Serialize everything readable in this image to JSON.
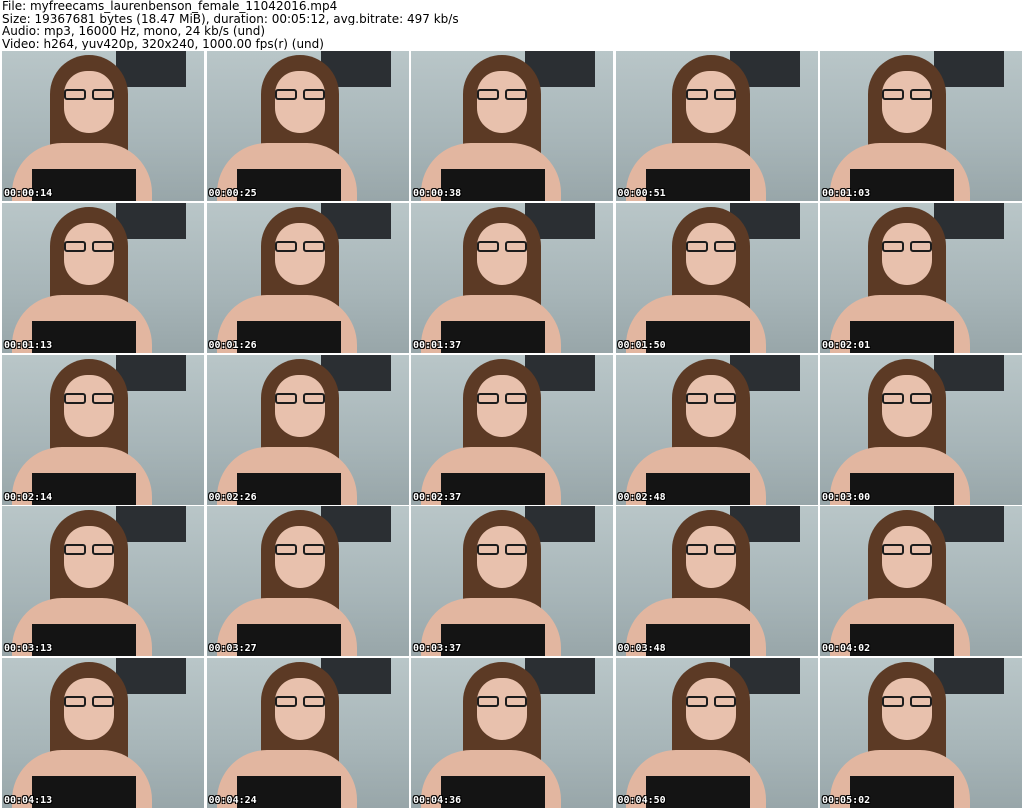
{
  "header": {
    "file_line": "File: myfreecams_laurenbenson_female_11042016.mp4",
    "size_line": "Size: 19367681 bytes (18.47 MiB), duration: 00:05:12, avg.bitrate: 497 kb/s",
    "audio_line": "Audio: mp3, 16000 Hz, mono, 24 kb/s (und)",
    "video_line": "Video: h264, yuv420p, 320x240, 1000.00 fps(r) (und)"
  },
  "thumbnails": [
    {
      "timestamp": "00:00:14"
    },
    {
      "timestamp": "00:00:25"
    },
    {
      "timestamp": "00:00:38"
    },
    {
      "timestamp": "00:00:51"
    },
    {
      "timestamp": "00:01:03"
    },
    {
      "timestamp": "00:01:13"
    },
    {
      "timestamp": "00:01:26"
    },
    {
      "timestamp": "00:01:37"
    },
    {
      "timestamp": "00:01:50"
    },
    {
      "timestamp": "00:02:01"
    },
    {
      "timestamp": "00:02:14"
    },
    {
      "timestamp": "00:02:26"
    },
    {
      "timestamp": "00:02:37"
    },
    {
      "timestamp": "00:02:48"
    },
    {
      "timestamp": "00:03:00"
    },
    {
      "timestamp": "00:03:13"
    },
    {
      "timestamp": "00:03:27"
    },
    {
      "timestamp": "00:03:37"
    },
    {
      "timestamp": "00:03:48"
    },
    {
      "timestamp": "00:04:02"
    },
    {
      "timestamp": "00:04:13"
    },
    {
      "timestamp": "00:04:24"
    },
    {
      "timestamp": "00:04:36"
    },
    {
      "timestamp": "00:04:50"
    },
    {
      "timestamp": "00:05:02"
    }
  ],
  "colors": {
    "background": "#ffffff",
    "header_text": "#000000",
    "timestamp_text": "#ffffff",
    "timestamp_outline": "#000000"
  }
}
